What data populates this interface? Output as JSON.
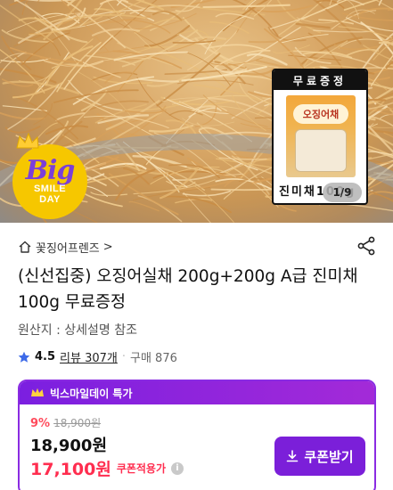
{
  "hero": {
    "badge": {
      "big": "Big",
      "smile": "SMILE",
      "day": "DAY"
    },
    "gift": {
      "header": "무료증정",
      "brand_on_pack": "오징어채",
      "caption": "진미채100g"
    },
    "image_counter": "1/9"
  },
  "store": {
    "name": "꽃징어프렌즈",
    "chevron": ">"
  },
  "product": {
    "title": "(신선집중) 오징어실채 200g+200g A급 진미채100g 무료증정",
    "origin": "원산지 : 상세설명 참조"
  },
  "rating": {
    "score": "4.5",
    "reviews": "리뷰 307개",
    "separator": "·",
    "purchases": "구매 876"
  },
  "promo": {
    "header": "빅스마일데이 특가",
    "discount_pct": "9%",
    "original_price": "18,900원",
    "price": "18,900원",
    "coupon_price": "17,100원",
    "coupon_note": "쿠폰적용가",
    "info_symbol": "i",
    "coupon_button": "쿠폰받기"
  },
  "colors": {
    "accent_purple": "#7b1fd9",
    "sale_red": "#ff2d4f",
    "badge_yellow": "#f6c700"
  }
}
